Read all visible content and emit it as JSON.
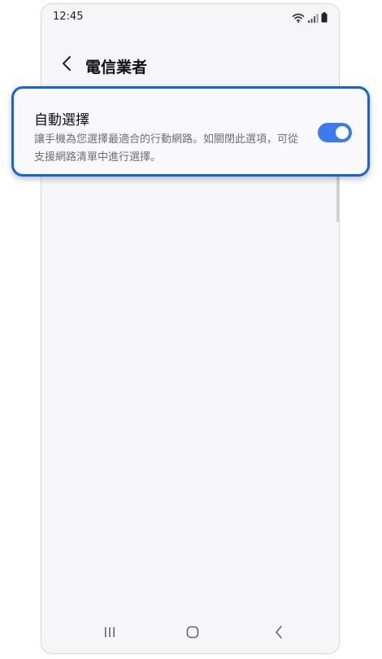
{
  "status_bar": {
    "time": "12:45",
    "icons": [
      "wifi-icon",
      "signal-icon",
      "battery-icon"
    ]
  },
  "header": {
    "back_icon": "chevron-left-icon",
    "title": "電信業者"
  },
  "setting": {
    "title": "自動選擇",
    "description": "讓手機為您選擇最適合的行動網路。如關閉此選項，可從支援網路清單中進行選擇。",
    "toggle_on": true
  },
  "nav_bar": {
    "icons": [
      "recents-icon",
      "home-icon",
      "back-icon"
    ]
  },
  "colors": {
    "accent": "#3a7bf2",
    "highlight_border": "#1565d8",
    "background": "#f6f6f8",
    "description_text": "#6e6e74"
  }
}
